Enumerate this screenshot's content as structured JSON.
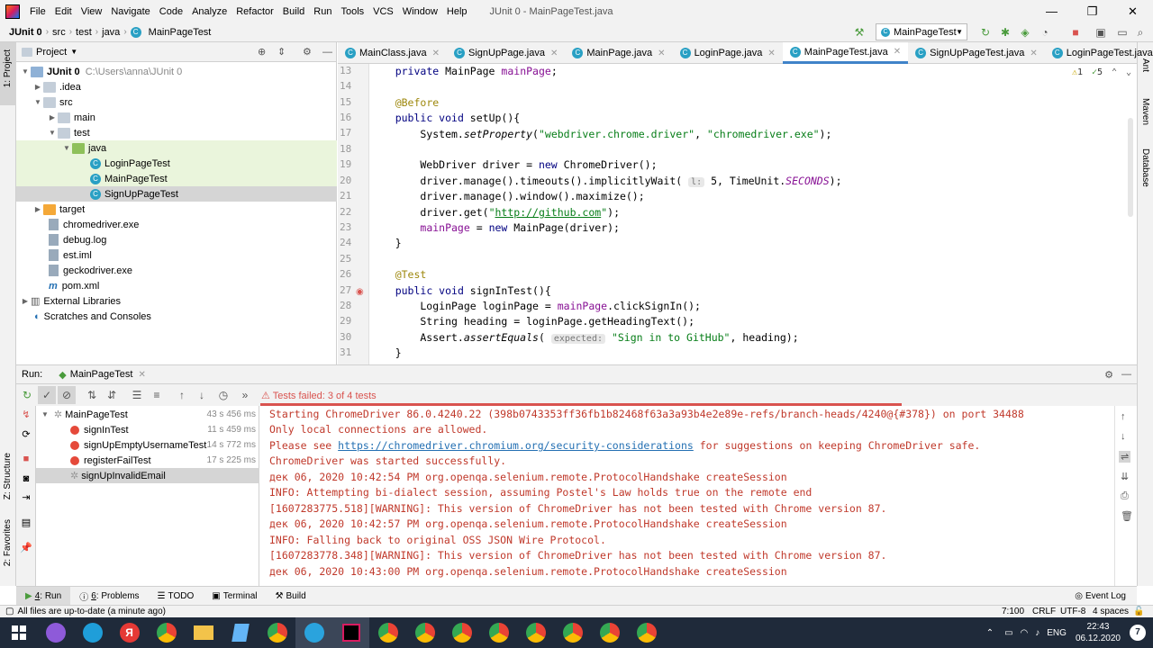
{
  "menubar": {
    "items": [
      "File",
      "Edit",
      "View",
      "Navigate",
      "Code",
      "Analyze",
      "Refactor",
      "Build",
      "Run",
      "Tools",
      "VCS",
      "Window",
      "Help"
    ],
    "title": "JUnit 0 - MainPageTest.java"
  },
  "navbar": {
    "crumbs": [
      "JUnit 0",
      "src",
      "test",
      "java",
      "MainPageTest"
    ],
    "run_config": "MainPageTest"
  },
  "project": {
    "header": "Project",
    "tree": [
      {
        "label": "JUnit 0",
        "extra": "C:\\Users\\anna\\JUnit 0",
        "kind": "module"
      },
      {
        "label": ".idea",
        "kind": "folder"
      },
      {
        "label": "src",
        "kind": "folder"
      },
      {
        "label": "main",
        "kind": "folder"
      },
      {
        "label": "test",
        "kind": "folder"
      },
      {
        "label": "java",
        "kind": "folder-green"
      },
      {
        "label": "LoginPageTest",
        "kind": "class"
      },
      {
        "label": "MainPageTest",
        "kind": "class"
      },
      {
        "label": "SignUpPageTest",
        "kind": "class"
      },
      {
        "label": "target",
        "kind": "folder-orange"
      },
      {
        "label": "chromedriver.exe",
        "kind": "file"
      },
      {
        "label": "debug.log",
        "kind": "file"
      },
      {
        "label": "est.iml",
        "kind": "file"
      },
      {
        "label": "geckodriver.exe",
        "kind": "file"
      },
      {
        "label": "pom.xml",
        "kind": "file"
      },
      {
        "label": "External Libraries",
        "kind": "lib"
      },
      {
        "label": "Scratches and Consoles",
        "kind": "scratch"
      }
    ]
  },
  "editor": {
    "tabs": [
      "MainClass.java",
      "SignUpPage.java",
      "MainPage.java",
      "LoginPage.java",
      "MainPageTest.java",
      "SignUpPageTest.java",
      "LoginPageTest.java"
    ],
    "active_tab": "MainPageTest.java",
    "warnings": "1",
    "checks": "5",
    "line_numbers": [
      "13",
      "14",
      "15",
      "16",
      "17",
      "18",
      "19",
      "20",
      "21",
      "22",
      "23",
      "24",
      "25",
      "26",
      "27",
      "28",
      "29",
      "30",
      "31"
    ]
  },
  "run": {
    "label": "Run:",
    "config_tab": "MainPageTest",
    "status": "Tests failed: 3 of 4 tests",
    "tests": [
      {
        "name": "MainPageTest",
        "time": "43 s 456 ms",
        "state": "root"
      },
      {
        "name": "signInTest",
        "time": "11 s 459 ms",
        "state": "error"
      },
      {
        "name": "signUpEmptyUsernameTest",
        "time": "14 s 772 ms",
        "state": "error"
      },
      {
        "name": "registerFailTest",
        "time": "17 s 225 ms",
        "state": "error"
      },
      {
        "name": "signUpInvalidEmail",
        "time": "",
        "state": "ignored"
      }
    ],
    "console": [
      "Starting ChromeDriver 86.0.4240.22 (398b0743353ff36fb1b82468f63a3a93b4e2e89e-refs/branch-heads/4240@{#378}) on port 34488",
      "Only local connections are allowed.",
      "",
      "ChromeDriver was started successfully.",
      "дек 06, 2020 10:42:54 PM org.openqa.selenium.remote.ProtocolHandshake createSession",
      "INFO: Attempting bi-dialect session, assuming Postel's Law holds true on the remote end",
      "[1607283775.518][WARNING]: This version of ChromeDriver has not been tested with Chrome version 87.",
      "дек 06, 2020 10:42:57 PM org.openqa.selenium.remote.ProtocolHandshake createSession",
      "INFO: Falling back to original OSS JSON Wire Protocol.",
      "[1607283778.348][WARNING]: This version of ChromeDriver has not been tested with Chrome version 87.",
      "дек 06, 2020 10:43:00 PM org.openqa.selenium.remote.ProtocolHandshake createSession"
    ],
    "console_line3_pre": "Please see ",
    "console_line3_link": "https://chromedriver.chromium.org/security-considerations",
    "console_line3_post": " for suggestions on keeping ChromeDriver safe."
  },
  "bottom_tabs": [
    {
      "num": "4",
      "label": "Run"
    },
    {
      "num": "6",
      "label": "Problems"
    },
    {
      "num": "",
      "label": "TODO"
    },
    {
      "num": "",
      "label": "Terminal"
    },
    {
      "num": "",
      "label": "Build"
    }
  ],
  "event_log": "Event Log",
  "statusbar": {
    "message": "All files are up-to-date (a minute ago)",
    "position": "7:100",
    "line_sep": "CRLF",
    "encoding": "UTF-8",
    "indent": "4 spaces"
  },
  "side_tools": {
    "left": [
      "1: Project",
      "Z: Structure",
      "2: Favorites"
    ],
    "right": [
      "Ant",
      "Maven",
      "Database"
    ]
  },
  "taskbar": {
    "lang": "ENG",
    "time": "22:43",
    "date": "06.12.2020",
    "notif": "7"
  }
}
